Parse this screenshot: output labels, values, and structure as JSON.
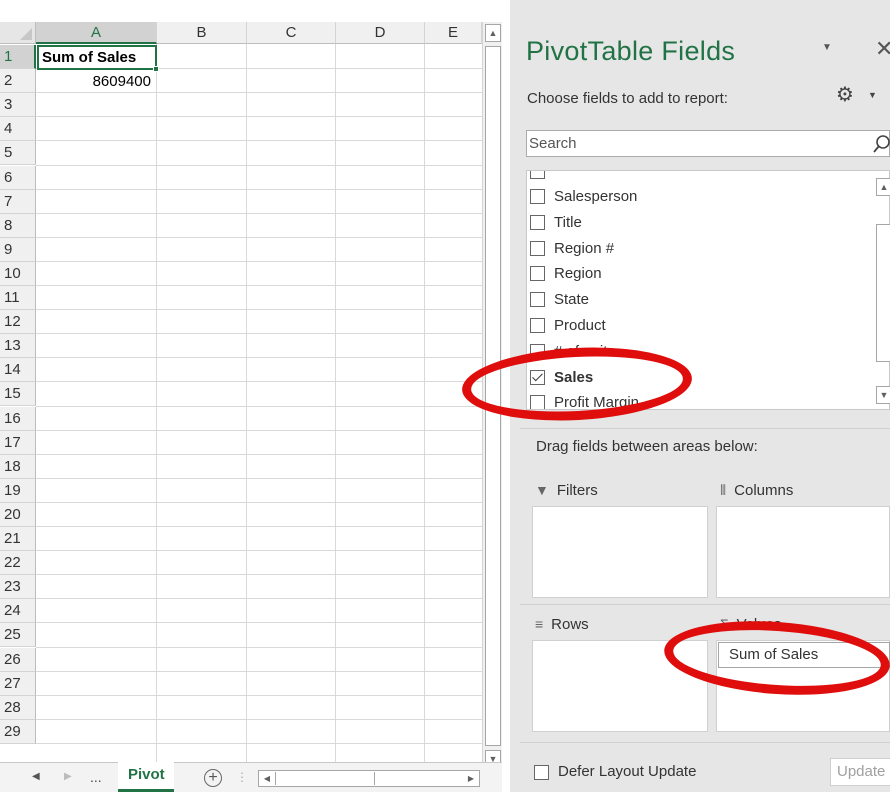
{
  "sheet": {
    "columns": [
      "A",
      "B",
      "C",
      "D",
      "E"
    ],
    "rows": [
      "1",
      "2",
      "3",
      "4",
      "5",
      "6",
      "7",
      "8",
      "9",
      "10",
      "11",
      "12",
      "13",
      "14",
      "15",
      "16",
      "17",
      "18",
      "19",
      "20",
      "21",
      "22",
      "23",
      "24",
      "25",
      "26",
      "27",
      "28",
      "29"
    ],
    "cells": {
      "a1": "Sum of Sales",
      "a2": "8609400"
    },
    "tabs": {
      "nav_more": "...",
      "active_tab": "Pivot"
    }
  },
  "pane": {
    "title": "PivotTable Fields",
    "choose_label": "Choose fields to add to report:",
    "search_placeholder": "Search",
    "fields": [
      {
        "label": "Salesperson",
        "checked": false
      },
      {
        "label": "Title",
        "checked": false
      },
      {
        "label": "Region #",
        "checked": false
      },
      {
        "label": "Region",
        "checked": false
      },
      {
        "label": "State",
        "checked": false
      },
      {
        "label": "Product",
        "checked": false
      },
      {
        "label": "# of units",
        "checked": false
      },
      {
        "label": "Sales",
        "checked": true
      },
      {
        "label": "Profit Margin",
        "checked": false
      }
    ],
    "drag_label": "Drag fields between areas below:",
    "areas": {
      "filters": "Filters",
      "columns": "Columns",
      "rows": "Rows",
      "values": "Values"
    },
    "values_chip": "Sum of Sales",
    "defer_label": "Defer Layout Update",
    "update_button": "Update"
  },
  "icons": {
    "gear": "gear-icon",
    "search": "search-icon",
    "close": "close-icon",
    "filter": "filter-icon",
    "columns": "columns-icon",
    "rows": "rows-icon",
    "sigma": "sigma-icon"
  },
  "colors": {
    "accent": "#217346",
    "annotation": "#e00d0d",
    "pane_bg": "#e6e6e6"
  }
}
